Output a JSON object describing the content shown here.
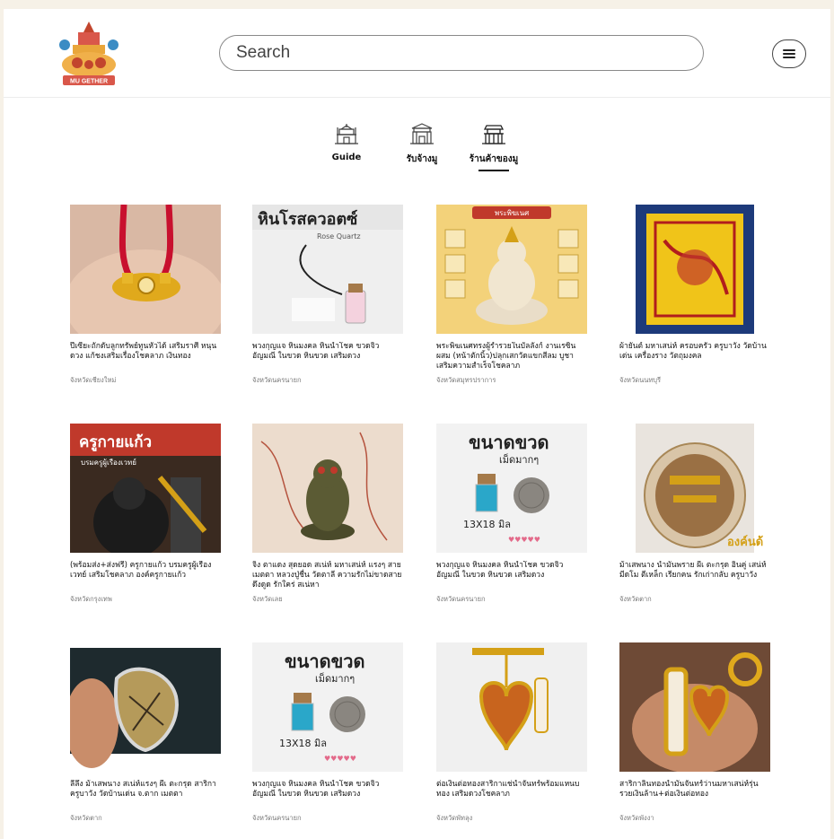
{
  "header": {
    "logo_text": "MU GETHER",
    "search_placeholder": "Search"
  },
  "nav": {
    "tabs": [
      {
        "label": "Guide",
        "active": false
      },
      {
        "label": "รับจ้างมู",
        "active": false
      },
      {
        "label": "ร้านค้าของมู",
        "active": true
      }
    ]
  },
  "products": [
    {
      "title": "ปี่เซียะถักดับลูกทรัพย์ทูนหัวได้ เสริมราศี หนุนดวง แก้ชงเสริมเรื่องโชคลาภ เงินทอง",
      "location": "จังหวัดเชียงใหม่"
    },
    {
      "title": "พวงกุญแจ หินมงคล หินนำโชค ขวดจิ๋ว อัญมณี ในขวด หินขวด เสริมดวง",
      "location": "จังหวัดนครนายก"
    },
    {
      "title": "พระพิฆเนศทรงผู้ร่ำรวยในบัลลังก์ งานเรซิ่นผสม (หน้าตักนิ้ว)ปลุกเสกวัดแขกสีลม บูชาเสริมความสำเร็จโชคลาภ",
      "location": "จังหวัดสมุทรปราการ"
    },
    {
      "title": "ผ้ายันต์ มหาเสน่ห์ ครอบครัว ครูบาวัง วัดบ้านเด่น เครื่องราง วัตถุมงคล",
      "location": "จังหวัดนนทบุรี"
    },
    {
      "title": "(พร้อมส่ง+ส่งฟรี) ครูกายแก้ว บรมครูผู้เรืองเวทย์ เสริมโชคลาภ องค์ครูกายแก้ว",
      "location": "จังหวัดกรุงเทพ"
    },
    {
      "title": "จิ้ง ตาแดง สุดยอด สเน่ห์ มหาเสน่ห์ แรงๆ สายเมตตา หลวงปู่ชื่น วัดตาลี ความรักไม่ขาดสาย ดึงดูด รักใคร่ สเน่หา",
      "location": "จังหวัดเลย"
    },
    {
      "title": "พวงกุญแจ หินมงคล หินนำโชค ขวดจิ๋ว อัญมณี ในขวด หินขวด เสริมดวง",
      "location": "จังหวัดนครนายก"
    },
    {
      "title": "ม้าเสพนาง น้ำมันพราย ผีเ ตะกรุด อิ่นคู่ เสน่ห์ มีดโม ตีเหล็ก เรียกคน รักเก่ากลับ ครูบาวัง",
      "location": "จังหวัดตาก"
    },
    {
      "title": "ลีลึ้ง ม้าเสพนาง สเน่ห์แรงๆ ผีเ ตะกรุด สาริกา ครูบาวัง วัดบ้านเด่น จ.ตาก เมตตา",
      "location": "จังหวัดตาก"
    },
    {
      "title": "พวงกุญแจ หินมงคล หินนำโชค ขวดจิ๋ว อัญมณี ในขวด หินขวด เสริมดวง",
      "location": "จังหวัดนครนายก"
    },
    {
      "title": "ต่อเงินต่อทองสาริกาแช่น้ำจันทร์พร้อมแหนบทอง เสริมดวงโชคลาภ",
      "location": "จังหวัดพัทลุง"
    },
    {
      "title": "สาริกาลิ้นทองน้ำมันจันทร์ว่านมหาเสน่ห์รุ่นรวยเงินล้าน+ต่อเงินต่อทอง",
      "location": "จังหวัดพังงา"
    }
  ],
  "image_texts": {
    "p2_heading": "หินโรสควอตซ์",
    "p2_sub": "Rose Quartz",
    "p3_banner": "พระพิฆเนศ",
    "p5_heading": "ครูกายแก้ว",
    "p5_sub": "บรมครูผู้เรืองเวทย์",
    "p7_heading": "ขนาดขวด",
    "p7_sub": "เม็ดมากๆ",
    "p7_size": "13X18 มิล",
    "p8_caption": "องค์นด้",
    "p10_heading": "ขนาดขวด",
    "p10_sub": "เม็ดมากๆ",
    "p10_size": "13X18 มิล"
  },
  "colors": {
    "page_bg": "#f6f1e7",
    "accent_gold": "#d4a017",
    "text": "#111111",
    "muted": "#777777"
  }
}
